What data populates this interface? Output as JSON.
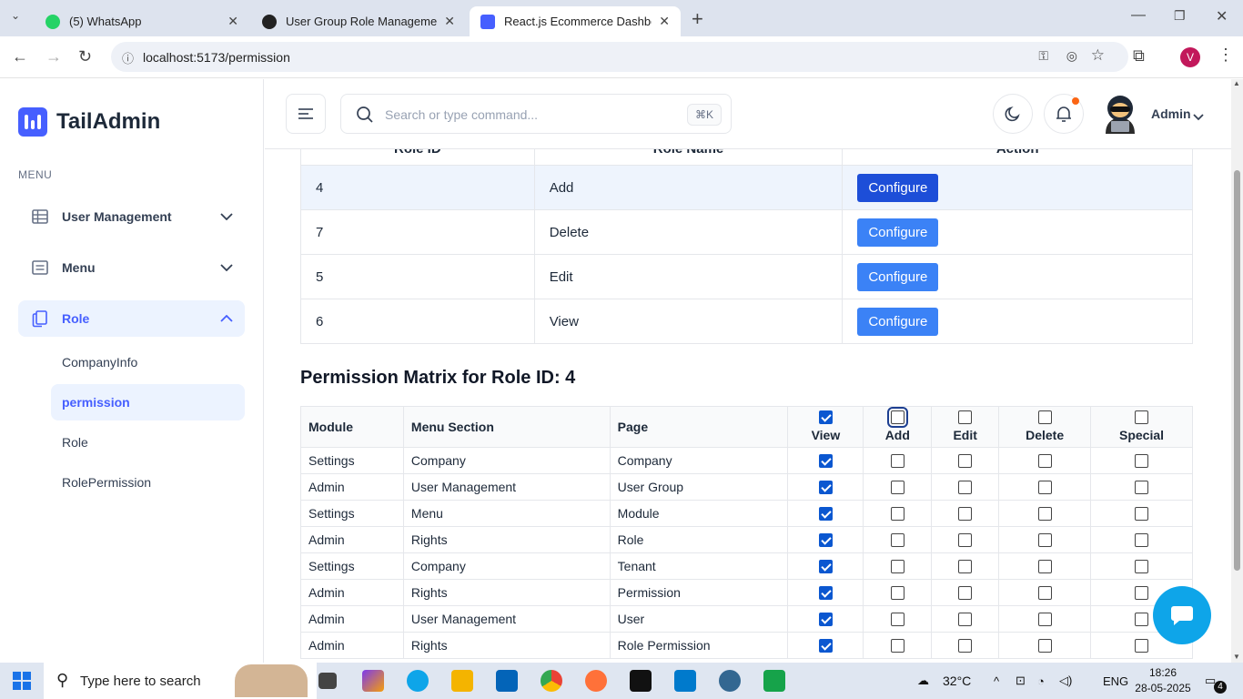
{
  "browser": {
    "tabs": [
      {
        "title": "(5) WhatsApp",
        "icon": "whatsapp-icon"
      },
      {
        "title": "User Group Role Management",
        "icon": "openai-icon"
      },
      {
        "title": "React.js Ecommerce Dashboard",
        "icon": "tailadmin-icon"
      }
    ],
    "url": "localhost:5173/permission",
    "profile_initial": "V"
  },
  "sidebar": {
    "brand": "TailAdmin",
    "menu_heading": "MENU",
    "items": [
      {
        "label": "User Management"
      },
      {
        "label": "Menu"
      },
      {
        "label": "Role"
      }
    ],
    "subitems": [
      {
        "label": "CompanyInfo"
      },
      {
        "label": "permission"
      },
      {
        "label": "Role"
      },
      {
        "label": "RolePermission"
      }
    ]
  },
  "header": {
    "search_placeholder": "Search or type command...",
    "shortcut": "⌘K",
    "user_name": "Admin"
  },
  "roles_table": {
    "headers": [
      "Role ID",
      "Role Name",
      "Action"
    ],
    "rows": [
      {
        "id": "4",
        "name": "Add",
        "action": "Configure"
      },
      {
        "id": "7",
        "name": "Delete",
        "action": "Configure"
      },
      {
        "id": "5",
        "name": "Edit",
        "action": "Configure"
      },
      {
        "id": "6",
        "name": "View",
        "action": "Configure"
      }
    ]
  },
  "matrix": {
    "title": "Permission Matrix for Role ID: 4",
    "headers": [
      "Module",
      "Menu Section",
      "Page",
      "View",
      "Add",
      "Edit",
      "Delete",
      "Special"
    ],
    "header_checks": [
      true,
      false,
      false,
      false,
      false
    ],
    "rows": [
      {
        "module": "Settings",
        "section": "Company",
        "page": "Company",
        "view": true
      },
      {
        "module": "Admin",
        "section": "User Management",
        "page": "User Group",
        "view": true
      },
      {
        "module": "Settings",
        "section": "Menu",
        "page": "Module",
        "view": true
      },
      {
        "module": "Admin",
        "section": "Rights",
        "page": "Role",
        "view": true
      },
      {
        "module": "Settings",
        "section": "Company",
        "page": "Tenant",
        "view": true
      },
      {
        "module": "Admin",
        "section": "Rights",
        "page": "Permission",
        "view": true
      },
      {
        "module": "Admin",
        "section": "User Management",
        "page": "User",
        "view": true
      },
      {
        "module": "Admin",
        "section": "Rights",
        "page": "Role Permission",
        "view": true
      }
    ]
  },
  "taskbar": {
    "search_placeholder": "Type here to search",
    "weather": "32°C",
    "lang": "ENG",
    "time": "18:26",
    "date": "28-05-2025",
    "notifications": "4"
  }
}
